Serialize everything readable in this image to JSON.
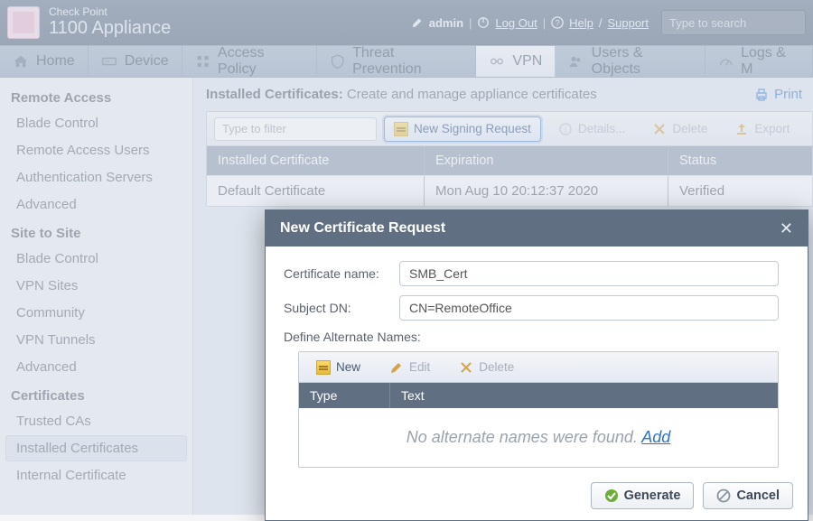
{
  "brand": {
    "line1": "Check Point",
    "line2": "1100 Appliance"
  },
  "header": {
    "admin": "admin",
    "logout": "Log Out",
    "help": "Help",
    "support": "Support",
    "search_placeholder": "Type to search"
  },
  "tabs": {
    "home": "Home",
    "device": "Device",
    "access": "Access Policy",
    "threat": "Threat Prevention",
    "vpn": "VPN",
    "users": "Users & Objects",
    "logs": "Logs & M"
  },
  "sidebar": {
    "group_remote": "Remote Access",
    "remote_items": [
      "Blade Control",
      "Remote Access Users",
      "Authentication Servers",
      "Advanced"
    ],
    "group_site": "Site to Site",
    "site_items": [
      "Blade Control",
      "VPN Sites",
      "Community",
      "VPN Tunnels",
      "Advanced"
    ],
    "group_cert": "Certificates",
    "cert_items": [
      "Trusted CAs",
      "Installed Certificates",
      "Internal Certificate"
    ]
  },
  "page": {
    "title_bold": "Installed Certificates:",
    "title_rest": " Create and manage appliance certificates",
    "print": "Print"
  },
  "toolbar": {
    "filter_placeholder": "Type to filter",
    "new_signing": "New Signing Request",
    "details": "Details...",
    "delete": "Delete",
    "export": "Export"
  },
  "table": {
    "col_name": "Installed Certificate",
    "col_exp": "Expiration",
    "col_status": "Status",
    "rows": [
      {
        "name": "Default Certificate",
        "exp": "Mon Aug 10 20:12:37 2020",
        "status": "Verified"
      }
    ]
  },
  "modal": {
    "title": "New Certificate Request",
    "cert_name_label": "Certificate name:",
    "cert_name_value": "SMB_Cert",
    "subject_label": "Subject DN:",
    "subject_value": "CN=RemoteOffice",
    "alt_label": "Define Alternate Names:",
    "alt_new": "New",
    "alt_edit": "Edit",
    "alt_delete": "Delete",
    "alt_col_type": "Type",
    "alt_col_text": "Text",
    "alt_empty": "No alternate names were found. ",
    "alt_add": "Add",
    "generate": "Generate",
    "cancel": "Cancel"
  }
}
